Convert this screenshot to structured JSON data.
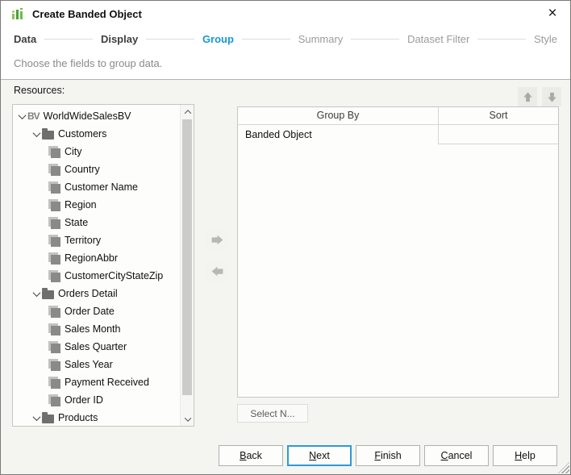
{
  "window": {
    "title": "Create Banded Object",
    "close_glyph": "×"
  },
  "steps": {
    "items": [
      {
        "label": "Data",
        "state": "done"
      },
      {
        "label": "Display",
        "state": "done"
      },
      {
        "label": "Group",
        "state": "active"
      },
      {
        "label": "Summary",
        "state": "upcoming"
      },
      {
        "label": "Dataset Filter",
        "state": "upcoming"
      },
      {
        "label": "Style",
        "state": "upcoming"
      }
    ]
  },
  "subtitle": "Choose the fields to group data.",
  "resources": {
    "label": "Resources:",
    "tree": [
      {
        "label": "WorldWideSalesBV",
        "type": "bv",
        "level": 0,
        "caret": true
      },
      {
        "label": "Customers",
        "type": "folder",
        "level": 1,
        "caret": true
      },
      {
        "label": "City",
        "type": "field",
        "level": 2
      },
      {
        "label": "Country",
        "type": "field",
        "level": 2
      },
      {
        "label": "Customer Name",
        "type": "field",
        "level": 2
      },
      {
        "label": "Region",
        "type": "field",
        "level": 2
      },
      {
        "label": "State",
        "type": "field",
        "level": 2
      },
      {
        "label": "Territory",
        "type": "field",
        "level": 2
      },
      {
        "label": "RegionAbbr",
        "type": "field",
        "level": 2
      },
      {
        "label": "CustomerCityStateZip",
        "type": "field",
        "level": 2
      },
      {
        "label": "Orders Detail",
        "type": "folder",
        "level": 1,
        "caret": true
      },
      {
        "label": "Order Date",
        "type": "field",
        "level": 2
      },
      {
        "label": "Sales Month",
        "type": "field",
        "level": 2
      },
      {
        "label": "Sales Quarter",
        "type": "field",
        "level": 2
      },
      {
        "label": "Sales Year",
        "type": "field",
        "level": 2
      },
      {
        "label": "Payment Received",
        "type": "field",
        "level": 2
      },
      {
        "label": "Order ID",
        "type": "field",
        "level": 2
      },
      {
        "label": "Products",
        "type": "folder",
        "level": 1,
        "caret": true
      },
      {
        "label": "",
        "type": "field",
        "level": 2,
        "partial": true
      }
    ],
    "bv_icon_text": "BV"
  },
  "group_table": {
    "columns": [
      "Group By",
      "Sort"
    ],
    "rows": [
      {
        "group_by": "Banded Object",
        "sort": ""
      }
    ]
  },
  "buttons": {
    "select_n": "Select N...",
    "back": {
      "mnemonic": "B",
      "rest": "ack"
    },
    "next": {
      "mnemonic": "N",
      "rest": "ext"
    },
    "finish": {
      "mnemonic": "F",
      "rest": "inish"
    },
    "cancel": {
      "mnemonic": "C",
      "rest": "ancel"
    },
    "help": {
      "mnemonic": "H",
      "rest": "elp"
    }
  },
  "icons": {
    "app_icon": "green-bar-chart-logo",
    "close_icon": "x-glyph",
    "caret_icon": "chevron-down",
    "folder_icon": "gray-folder",
    "field_icon": "gray-stacked-square",
    "move_up_icon": "up-arrow",
    "move_down_icon": "down-arrow",
    "add_field_icon": "right-arrow",
    "remove_field_icon": "left-arrow",
    "resize_grip_icon": "diagonal-stripes"
  },
  "colors": {
    "active_step": "#1898d5",
    "next_button_border": "#2e9ad6",
    "logo_green_light": "#8bc34a",
    "logo_green_dark": "#4f9e3e",
    "body_background": "#f4f4f1",
    "disabled_arrow": "#b0b0ad"
  }
}
